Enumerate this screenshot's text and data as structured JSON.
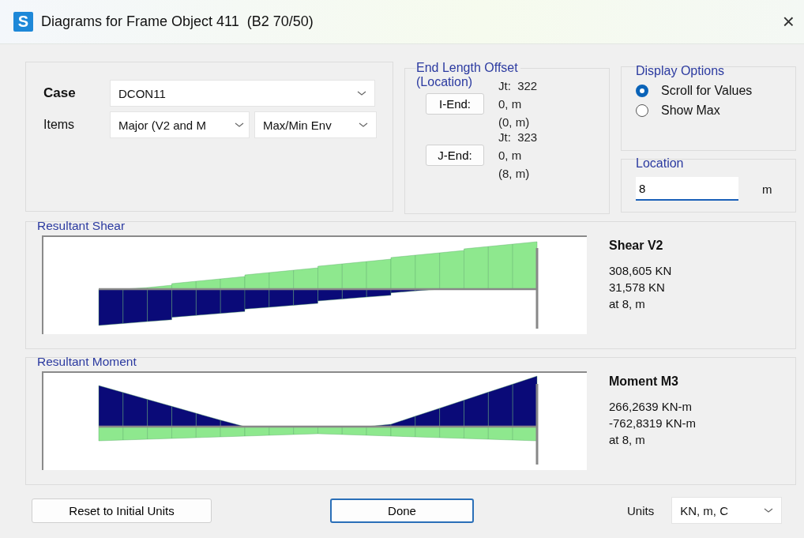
{
  "window": {
    "icon_letter": "S",
    "title": "Diagrams for Frame Object 411  (B2 70/50)",
    "close": "×"
  },
  "case": {
    "label": "Case",
    "value": "DCON11"
  },
  "items": {
    "label": "Items",
    "component": "Major (V2 and M",
    "envelope": "Max/Min Env"
  },
  "end_length_offset": {
    "title": "End Length Offset",
    "subtitle": "(Location)",
    "ends": [
      {
        "joint": "Jt:  322",
        "button": "I-End:",
        "offset": "0, m",
        "location": "(0, m)"
      },
      {
        "joint": "Jt:  323",
        "button": "J-End:",
        "offset": "0, m",
        "location": "(8, m)"
      }
    ]
  },
  "display_options": {
    "title": "Display Options",
    "options": [
      {
        "label": "Scroll for Values",
        "selected": true
      },
      {
        "label": "Show Max",
        "selected": false
      }
    ]
  },
  "location": {
    "title": "Location",
    "value": "8",
    "unit": "m"
  },
  "sections": [
    {
      "kind": "shear",
      "title": "Resultant Shear",
      "heading": "Shear V2",
      "values": [
        "308,605 KN",
        "31,578 KN",
        "at 8, m"
      ]
    },
    {
      "kind": "moment",
      "title": "Resultant Moment",
      "heading": "Moment M3",
      "values": [
        "266,2639 KN-m",
        "-762,8319 KN-m",
        "at 8, m"
      ]
    }
  ],
  "footer": {
    "reset_button": "Reset to Initial Units",
    "done_button": "Done",
    "units_label": "Units",
    "units_value": "KN, m, C"
  }
}
